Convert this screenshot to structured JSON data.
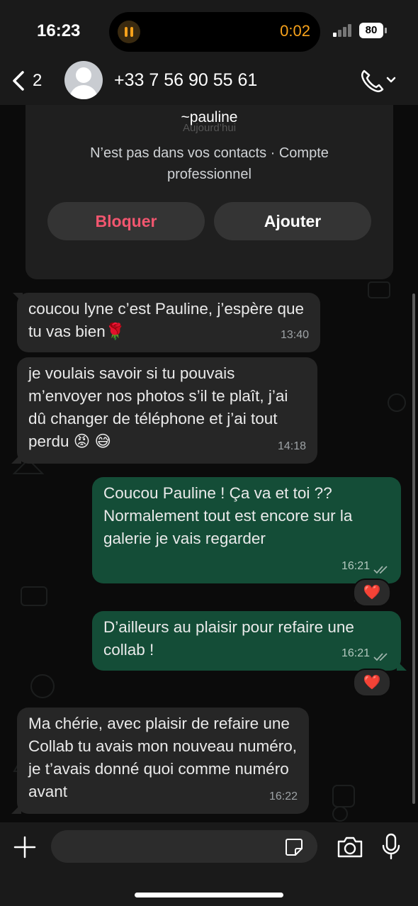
{
  "status_bar": {
    "time": "16:23",
    "recording_time": "0:02",
    "battery": "80"
  },
  "header": {
    "back_count": "2",
    "contact_name": "+33 7 56 90 55 61",
    "icons": [
      "back-chevron-icon",
      "avatar-placeholder-icon",
      "phone-call-icon",
      "chevron-down-icon"
    ]
  },
  "info_card": {
    "name": "~pauline",
    "date_label": "Aujourd’hui",
    "description": "N’est pas dans vos contacts · Compte professionnel",
    "block_label": "Bloquer",
    "add_label": "Ajouter"
  },
  "messages": [
    {
      "direction": "in",
      "text": "coucou lyne c’est Pauline, j’espère que tu vas bien🌹",
      "time": "13:40"
    },
    {
      "direction": "in",
      "text": "je voulais savoir si tu pouvais m’envoyer nos photos s’il te plaît, j’ai dû changer de téléphone et j’ai tout perdu 😡 😅",
      "time": "14:18"
    },
    {
      "direction": "out",
      "text": "Coucou Pauline ! Ça va et toi ?? Normalement tout est encore sur la galerie je vais regarder",
      "time": "16:21",
      "reaction": "❤️",
      "read": true
    },
    {
      "direction": "out",
      "text": "D’ailleurs au plaisir pour refaire une collab !",
      "time": "16:21",
      "reaction": "❤️",
      "read": true
    },
    {
      "direction": "in",
      "text": "Ma chérie, avec plaisir de refaire une Collab tu avais mon nouveau numéro, je t’avais donné quoi comme numéro avant",
      "time": "16:22"
    }
  ],
  "composer": {
    "placeholder": "",
    "icons": [
      "plus-icon",
      "sticker-icon",
      "camera-icon",
      "microphone-icon"
    ]
  },
  "colors": {
    "incoming_bubble": "#262626",
    "outgoing_bubble": "#144d37",
    "block_red": "#f2566f",
    "recording_orange": "#f7a21b"
  }
}
